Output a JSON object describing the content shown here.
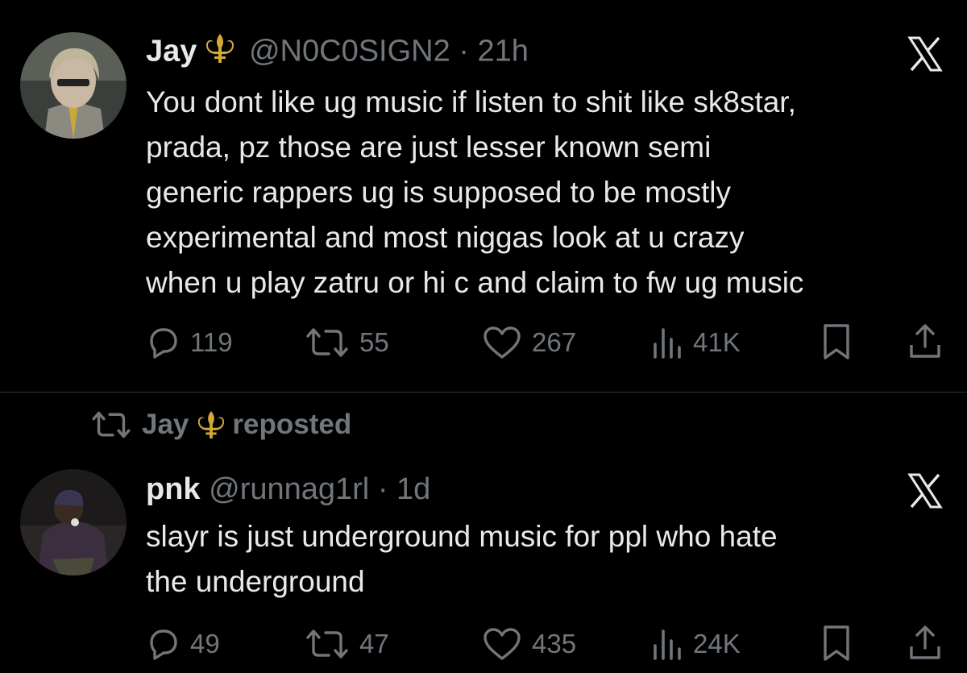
{
  "tweets": [
    {
      "author_name": "Jay",
      "author_handle": "@N0C0SIGN2",
      "separator": "·",
      "time": "21h",
      "lines": [
        "You dont like ug music if listen to shit like sk8star,",
        "prada, pz those are just lesser known semi",
        "generic rappers ug  is supposed to be mostly",
        "experimental and most niggas look at u crazy",
        "when u play zatru or hi c and claim to fw ug music"
      ],
      "replies": "119",
      "reposts": "55",
      "likes": "267",
      "views": "41K"
    },
    {
      "repost_by": "Jay",
      "repost_label": "reposted",
      "author_name": "pnk",
      "author_handle": "@runnag1rl",
      "separator": "·",
      "time": "1d",
      "lines": [
        "slayr is just underground music for ppl who hate",
        "the underground"
      ],
      "replies": "49",
      "reposts": "47",
      "likes": "435",
      "views": "24K"
    }
  ],
  "colors": {
    "background": "#000000",
    "text_primary": "#e7e9ea",
    "text_secondary": "#71767b",
    "divider": "#2f3336",
    "fleur_gold": "#d4a937"
  },
  "icons": [
    "reply-icon",
    "repost-icon",
    "like-icon",
    "views-icon",
    "bookmark-icon",
    "share-icon",
    "x-logo-icon",
    "fleur-de-lis-icon"
  ]
}
